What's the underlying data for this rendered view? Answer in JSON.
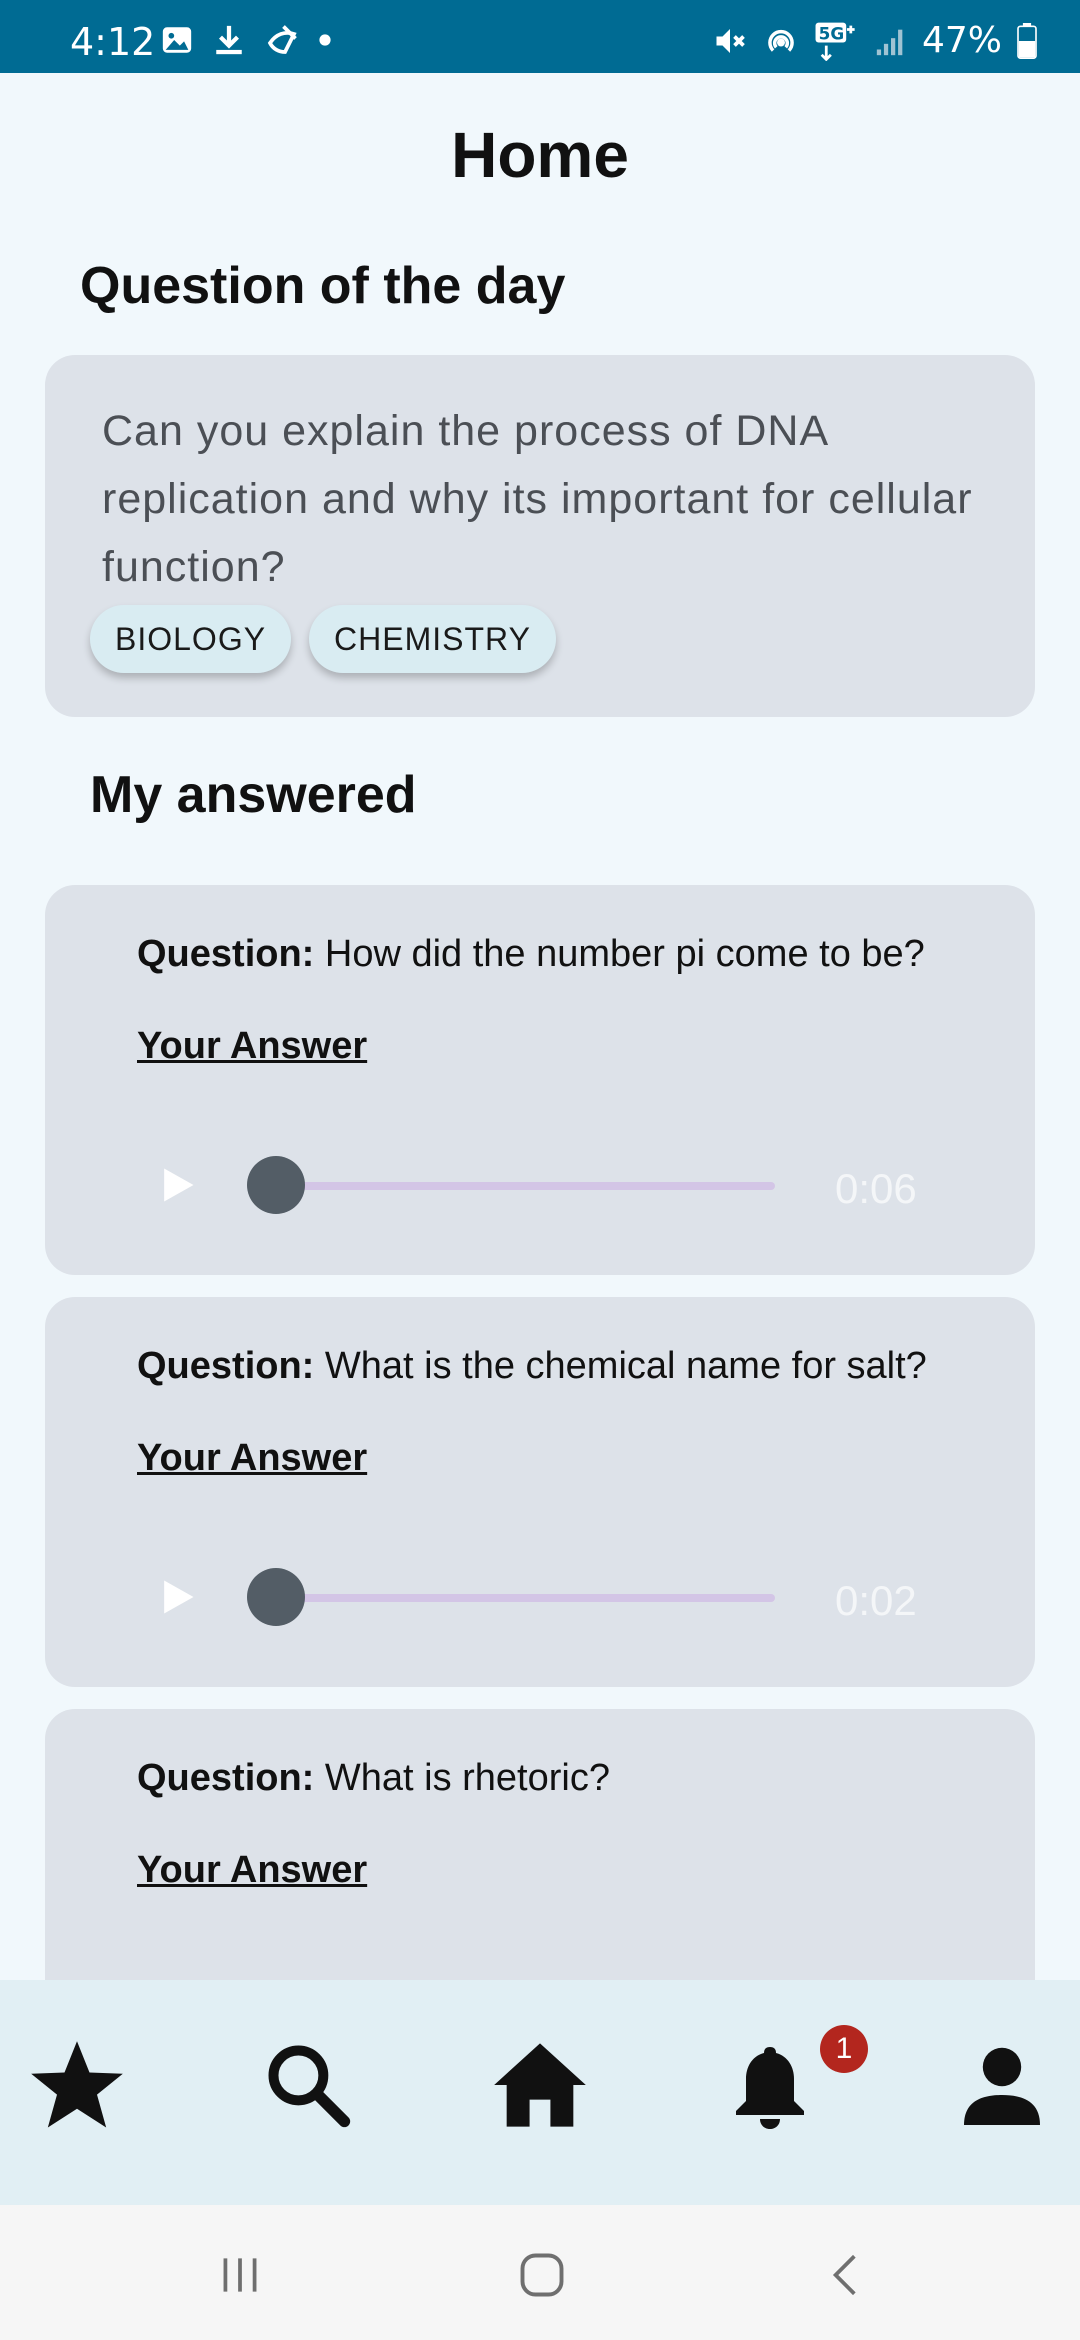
{
  "status_bar": {
    "time": "4:12",
    "battery": "47%",
    "background": "#006b93"
  },
  "page": {
    "title": "Home"
  },
  "question_of_day": {
    "section_title": "Question of the day",
    "text": "Can you explain the process of DNA replication and why its important for cellular function?",
    "tags": [
      "BIOLOGY",
      "CHEMISTRY"
    ]
  },
  "answered": {
    "section_title": "My answered",
    "question_prefix": "Question:",
    "answer_label": "Your Answer",
    "items": [
      {
        "question": "How did the number pi come to be?",
        "duration": "0:06",
        "progress": 0
      },
      {
        "question": "What is the chemical name for salt?",
        "duration": "0:02",
        "progress": 0
      },
      {
        "question": "What is rhetoric?"
      }
    ]
  },
  "bottom_nav": {
    "items": [
      {
        "icon": "star-icon"
      },
      {
        "icon": "search-icon"
      },
      {
        "icon": "home-icon"
      },
      {
        "icon": "bell-icon",
        "badge": "1"
      },
      {
        "icon": "person-icon"
      }
    ]
  },
  "system_nav": {
    "icons": [
      "recent-apps-icon",
      "home-button-icon",
      "back-icon"
    ]
  },
  "colors": {
    "card": "#dde2e9",
    "chip": "#d9ecf2",
    "track": "#d3c5e6",
    "thumb": "#535d66",
    "badge": "#b3261e",
    "nav": "#e1eff4"
  }
}
